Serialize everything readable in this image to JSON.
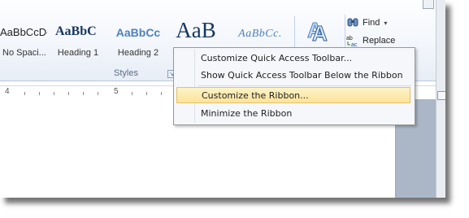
{
  "ribbon": {
    "styles": [
      {
        "sample": "AaBbCcDc",
        "name": "No Spaci..."
      },
      {
        "sample": "AaBbC",
        "name": "Heading 1"
      },
      {
        "sample": "AaBbCc",
        "name": "Heading 2"
      },
      {
        "sample": "AaB",
        "name": ""
      },
      {
        "sample": "AaBbCc.",
        "name": ""
      }
    ],
    "styles_group_label": "Styles",
    "editing": {
      "find_label": "Find",
      "replace_label": "Replace"
    }
  },
  "ruler": {
    "numbers": [
      "4",
      "5"
    ]
  },
  "context_menu": {
    "items": [
      {
        "label": "Customize Quick Access Toolbar..."
      },
      {
        "label": "Show Quick Access Toolbar Below the Ribbon"
      },
      {
        "label": "Customize the Ribbon..."
      },
      {
        "label": "Minimize the Ribbon"
      }
    ]
  },
  "colors": {
    "heading_blue": "#17365d",
    "heading2_blue": "#4f81bd",
    "highlight": "#fbe39a"
  }
}
